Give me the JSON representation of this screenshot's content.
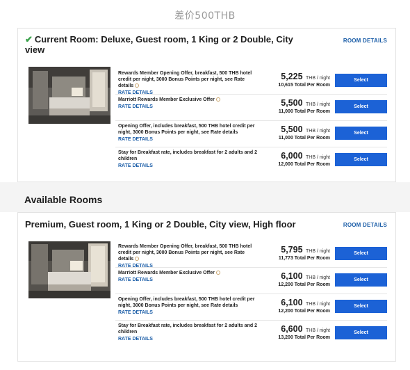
{
  "caption": "差价500THB",
  "current_room": {
    "title": "Current Room: Deluxe, Guest room, 1 King or 2 Double, City view",
    "details_label": "ROOM DETAILS",
    "rates": [
      {
        "desc": "Rewards Member Opening Offer, breakfast, 500 THB hotel credit per night, 3000 Bonus Points per night, see Rate details",
        "link": "RATE DETAILS",
        "price": "5,225",
        "unit": "THB / night",
        "total": "10,615 Total Per Room",
        "button": "Select"
      },
      {
        "desc": "Marriott Rewards Member Exclusive Offer",
        "link": "RATE DETAILS",
        "price": "5,500",
        "unit": "THB / night",
        "total": "11,000 Total Per Room",
        "button": "Select"
      },
      {
        "desc": "Opening Offer, includes breakfast, 500 THB hotel credit per night, 3000 Bonus Points per night, see Rate details",
        "link": "RATE DETAILS",
        "price": "5,500",
        "unit": "THB / night",
        "total": "11,000 Total Per Room",
        "button": "Select"
      },
      {
        "desc": "Stay for Breakfast rate, includes breakfast for 2 adults and 2 children",
        "link": "RATE DETAILS",
        "price": "6,000",
        "unit": "THB / night",
        "total": "12,000 Total Per Room",
        "button": "Select"
      }
    ]
  },
  "available_section_title": "Available Rooms",
  "available_room": {
    "title": "Premium, Guest room, 1 King or 2 Double, City view, High floor",
    "details_label": "ROOM DETAILS",
    "rates": [
      {
        "desc": "Rewards Member Opening Offer, breakfast, 500 THB hotel credit per night, 3000 Bonus Points per night, see Rate details",
        "link": "RATE DETAILS",
        "price": "5,795",
        "unit": "THB / night",
        "total": "11,773 Total Per Room",
        "button": "Select"
      },
      {
        "desc": "Marriott Rewards Member Exclusive Offer",
        "link": "RATE DETAILS",
        "price": "6,100",
        "unit": "THB / night",
        "total": "12,200 Total Per Room",
        "button": "Select"
      },
      {
        "desc": "Opening Offer, includes breakfast, 500 THB hotel credit per night, 3000 Bonus Points per night, see Rate details",
        "link": "RATE DETAILS",
        "price": "6,100",
        "unit": "THB / night",
        "total": "12,200 Total Per Room",
        "button": "Select"
      },
      {
        "desc": "Stay for Breakfast rate, includes breakfast for 2 adults and 2 children",
        "link": "RATE DETAILS",
        "price": "6,600",
        "unit": "THB / night",
        "total": "13,200 Total Per Room",
        "button": "Select"
      }
    ]
  }
}
